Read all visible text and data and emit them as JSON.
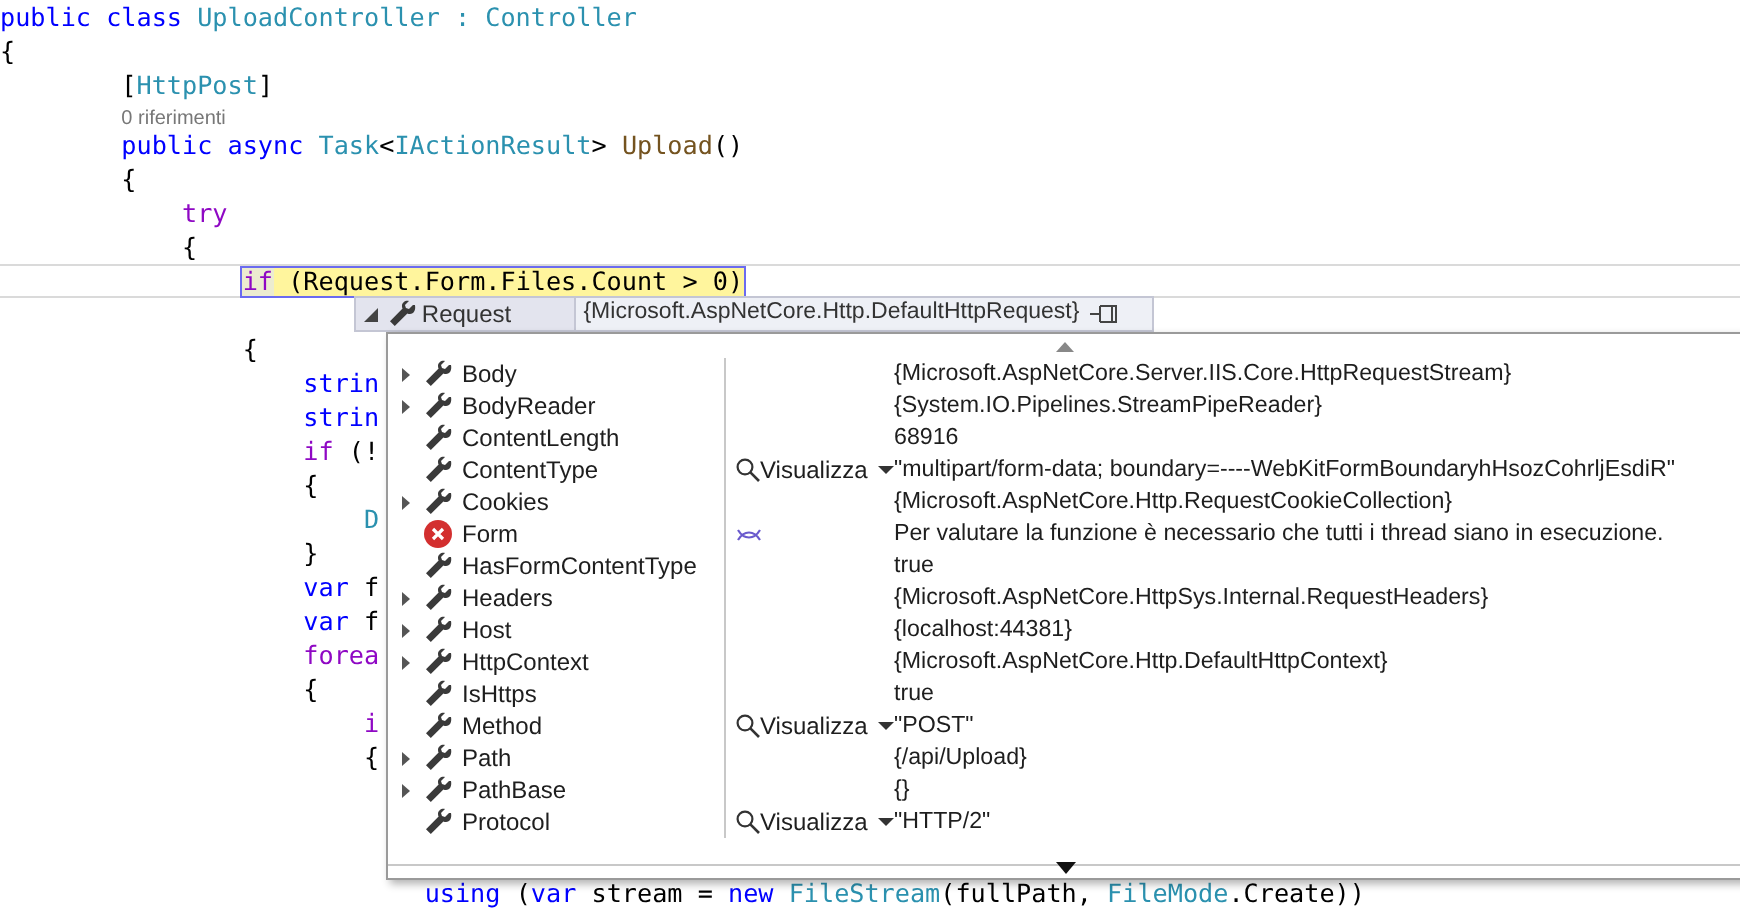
{
  "code_lines": [
    {
      "kind": "code",
      "tokens": [
        {
          "text": "public",
          "kind": "keyword"
        },
        {
          "text": " class",
          "kind": "keyword"
        },
        {
          "text": " UploadController : Controller",
          "kind": "type"
        }
      ]
    },
    {
      "kind": "code",
      "tokens": [
        {
          "text": "{",
          "kind": "plain"
        }
      ]
    },
    {
      "kind": "code",
      "tokens": [
        {
          "text": "        [",
          "kind": "plain"
        },
        {
          "text": "HttpPost",
          "kind": "type"
        },
        {
          "text": "]",
          "kind": "plain"
        }
      ]
    },
    {
      "kind": "codelens",
      "tokens": [
        {
          "text": "        0 riferimenti",
          "kind": "lens"
        }
      ]
    },
    {
      "kind": "code",
      "tokens": [
        {
          "text": "        public",
          "kind": "keyword"
        },
        {
          "text": " async",
          "kind": "keyword"
        },
        {
          "text": " Task",
          "kind": "type"
        },
        {
          "text": "<",
          "kind": "plain"
        },
        {
          "text": "IActionResult",
          "kind": "type"
        },
        {
          "text": "> ",
          "kind": "plain"
        },
        {
          "text": "Upload",
          "kind": "method"
        },
        {
          "text": "()",
          "kind": "plain"
        }
      ]
    },
    {
      "kind": "code",
      "tokens": [
        {
          "text": "        {",
          "kind": "plain"
        }
      ]
    },
    {
      "kind": "code",
      "tokens": [
        {
          "text": "            try",
          "kind": "control"
        }
      ]
    },
    {
      "kind": "code",
      "tokens": [
        {
          "text": "            {",
          "kind": "plain"
        }
      ]
    },
    {
      "kind": "current",
      "tokens": [
        {
          "text": "                if",
          "kind": "control"
        },
        {
          "text": " (Request.Form.Files.Count > 0)",
          "kind": "plain"
        }
      ]
    },
    {
      "kind": "blank"
    },
    {
      "kind": "code",
      "tokens": [
        {
          "text": "                {",
          "kind": "plain"
        }
      ]
    },
    {
      "kind": "code",
      "tokens": [
        {
          "text": "                    strin",
          "kind": "keyword"
        }
      ]
    },
    {
      "kind": "code",
      "tokens": [
        {
          "text": "                    strin",
          "kind": "keyword"
        }
      ]
    },
    {
      "kind": "code",
      "tokens": [
        {
          "text": "                    if",
          "kind": "control"
        },
        {
          "text": " (!",
          "kind": "plain"
        }
      ]
    },
    {
      "kind": "code",
      "tokens": [
        {
          "text": "                    {",
          "kind": "plain"
        }
      ]
    },
    {
      "kind": "code",
      "tokens": [
        {
          "text": "                        D",
          "kind": "type"
        }
      ]
    },
    {
      "kind": "code",
      "tokens": [
        {
          "text": "                    }",
          "kind": "plain"
        }
      ]
    },
    {
      "kind": "code",
      "tokens": [
        {
          "text": "                    var",
          "kind": "keyword"
        },
        {
          "text": " f",
          "kind": "plain"
        }
      ]
    },
    {
      "kind": "code",
      "tokens": [
        {
          "text": "                    var",
          "kind": "keyword"
        },
        {
          "text": " f",
          "kind": "plain"
        }
      ]
    },
    {
      "kind": "code",
      "tokens": [
        {
          "text": "                    forea",
          "kind": "control"
        }
      ]
    },
    {
      "kind": "code",
      "tokens": [
        {
          "text": "                    {",
          "kind": "plain"
        }
      ]
    },
    {
      "kind": "code",
      "tokens": [
        {
          "text": "                        i",
          "kind": "control"
        }
      ]
    },
    {
      "kind": "code",
      "tokens": [
        {
          "text": "                        {",
          "kind": "plain"
        }
      ]
    },
    {
      "kind": "blank"
    },
    {
      "kind": "blank"
    },
    {
      "kind": "blank"
    },
    {
      "kind": "code",
      "tokens": [
        {
          "text": "                            using",
          "kind": "keyword"
        },
        {
          "text": " (",
          "kind": "plain"
        },
        {
          "text": "var",
          "kind": "keyword"
        },
        {
          "text": " stream = ",
          "kind": "plain"
        },
        {
          "text": "new",
          "kind": "keyword"
        },
        {
          "text": " FileStream",
          "kind": "type"
        },
        {
          "text": "(fullPath, ",
          "kind": "plain"
        },
        {
          "text": "FileMode",
          "kind": "type"
        },
        {
          "text": ".Create))",
          "kind": "plain"
        }
      ]
    }
  ],
  "datatip": {
    "expanded": true,
    "name": "Request",
    "value": "{Microsoft.AspNetCore.Http.DefaultHttpRequest}",
    "rows": [
      {
        "name": "Body",
        "expandable": true,
        "kind": "property",
        "reevaluate": false,
        "value": "{Microsoft.AspNetCore.Server.IIS.Core.HttpRequestStream}"
      },
      {
        "name": "BodyReader",
        "expandable": true,
        "kind": "property",
        "reevaluate": false,
        "value": "{System.IO.Pipelines.StreamPipeReader}"
      },
      {
        "name": "ContentLength",
        "expandable": false,
        "kind": "property",
        "reevaluate": false,
        "value": "68916"
      },
      {
        "name": "ContentType",
        "expandable": false,
        "kind": "property",
        "visualizer": "Visualizza",
        "reevaluate": false,
        "value": "\"multipart/form-data; boundary=----WebKitFormBoundaryhHsozCohrljEsdiR\""
      },
      {
        "name": "Cookies",
        "expandable": true,
        "kind": "property",
        "reevaluate": false,
        "value": "{Microsoft.AspNetCore.Http.RequestCookieCollection}"
      },
      {
        "name": "Form",
        "expandable": false,
        "kind": "error",
        "reevaluate": true,
        "value": "Per valutare la funzione è necessario che tutti i thread siano in esecuzione."
      },
      {
        "name": "HasFormContentType",
        "expandable": false,
        "kind": "property",
        "reevaluate": false,
        "value": "true"
      },
      {
        "name": "Headers",
        "expandable": true,
        "kind": "property",
        "reevaluate": false,
        "value": "{Microsoft.AspNetCore.HttpSys.Internal.RequestHeaders}"
      },
      {
        "name": "Host",
        "expandable": true,
        "kind": "property",
        "reevaluate": false,
        "value": "{localhost:44381}"
      },
      {
        "name": "HttpContext",
        "expandable": true,
        "kind": "property",
        "reevaluate": false,
        "value": "{Microsoft.AspNetCore.Http.DefaultHttpContext}"
      },
      {
        "name": "IsHttps",
        "expandable": false,
        "kind": "property",
        "reevaluate": false,
        "value": "true"
      },
      {
        "name": "Method",
        "expandable": false,
        "kind": "property",
        "visualizer": "Visualizza",
        "reevaluate": false,
        "value": "\"POST\""
      },
      {
        "name": "Path",
        "expandable": true,
        "kind": "property",
        "reevaluate": false,
        "value": "{/api/Upload}"
      },
      {
        "name": "PathBase",
        "expandable": true,
        "kind": "property",
        "reevaluate": false,
        "value": "{}"
      },
      {
        "name": "Protocol",
        "expandable": false,
        "kind": "property",
        "visualizer": "Visualizza",
        "reevaluate": false,
        "value": "\"HTTP/2\""
      }
    ]
  }
}
